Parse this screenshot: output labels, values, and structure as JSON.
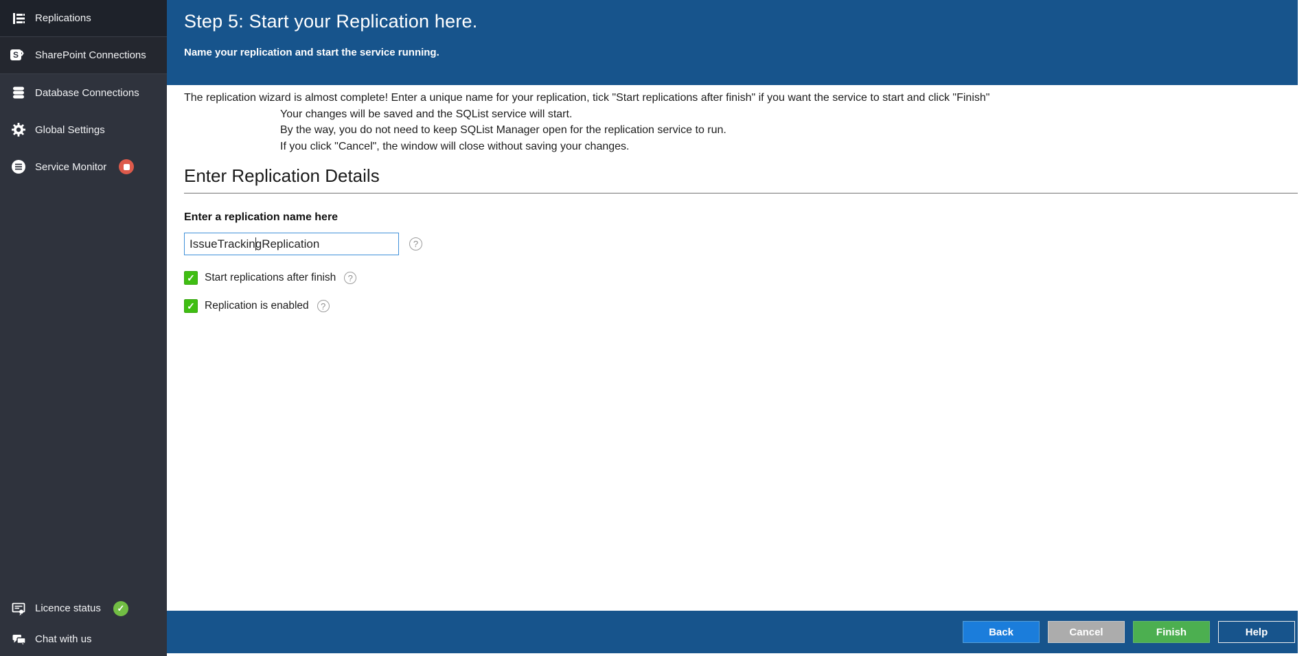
{
  "sidebar": {
    "items": [
      {
        "label": "Replications",
        "icon": "replications-icon"
      },
      {
        "label": "SharePoint Connections",
        "icon": "sharepoint-icon"
      },
      {
        "label": "Database Connections",
        "icon": "database-icon"
      },
      {
        "label": "Global Settings",
        "icon": "gear-icon"
      },
      {
        "label": "Service Monitor",
        "icon": "service-monitor-icon",
        "badge": "stop"
      }
    ],
    "footer_items": [
      {
        "label": "Licence status",
        "icon": "licence-icon",
        "badge": "check"
      },
      {
        "label": "Chat with us",
        "icon": "chat-icon"
      }
    ]
  },
  "header": {
    "title": "Step 5: Start your Replication here.",
    "subtitle": "Name your replication and start the service running."
  },
  "intro": {
    "line1": "The replication wizard is almost complete! Enter a unique name for your replication, tick \"Start replications after finish\" if you want the service to start and click \"Finish\"",
    "line2": "Your changes will be saved and the SQList service will start.",
    "line3": "By the way, you do not need to keep SQList Manager open for the replication service to run.",
    "line4": "If you click \"Cancel\", the window will close without saving your changes."
  },
  "section": {
    "title": "Enter Replication Details"
  },
  "form": {
    "name_label": "Enter a replication name here",
    "name_value": "IssueTrackingReplication",
    "checkboxes": [
      {
        "label": "Start replications after finish",
        "checked": true
      },
      {
        "label": "Replication is enabled",
        "checked": true
      }
    ]
  },
  "footer": {
    "buttons": [
      {
        "label": "Back"
      },
      {
        "label": "Cancel"
      },
      {
        "label": "Finish"
      },
      {
        "label": "Help"
      }
    ]
  },
  "icons": {
    "help": "?",
    "check": "✓",
    "sharepoint_s": "S",
    "sharepoint_chevron": "›"
  },
  "colors": {
    "header_blue": "#17548C",
    "sidebar_dark": "#2F333D",
    "checkbox_green": "#3FBE12",
    "stop_red": "#DD5A4B",
    "status_green": "#72BE44",
    "back_blue": "#1B7DDB",
    "cancel_gray": "#ACACAC",
    "finish_green": "#4CAF50",
    "input_border_blue": "#3D8FD9"
  }
}
